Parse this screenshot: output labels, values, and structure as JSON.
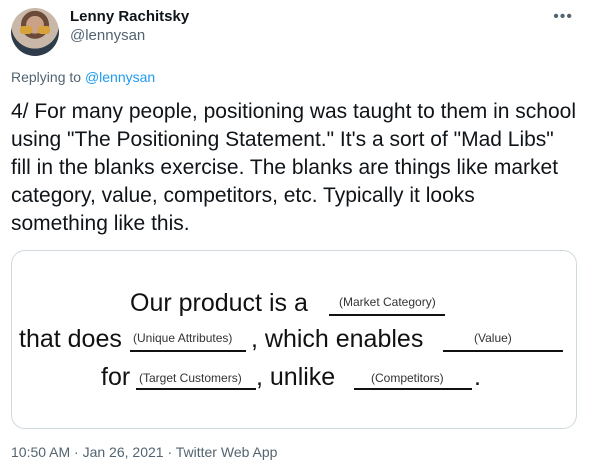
{
  "author": {
    "name": "Lenny Rachitsky",
    "handle": "@lennysan"
  },
  "reply": {
    "prefix": "Replying to",
    "handle": "@lennysan"
  },
  "tweet": {
    "text": "4/ For many people, positioning was taught to them in school using \"The Positioning Statement.\" It's a sort of \"Mad Libs\" fill in the blanks exercise. The blanks are things like market category, value, competitors, etc. Typically it looks something like this."
  },
  "statement": {
    "line1": "Our product is a",
    "line2a": "that does",
    "line2b": ", which enables",
    "line3a": "for",
    "line3b": ", unlike",
    "line3c": ".",
    "blanks": {
      "market_category": "(Market Category)",
      "unique_attributes": "(Unique Attributes)",
      "value": "(Value)",
      "target_customers": "(Target Customers)",
      "competitors": "(Competitors)"
    }
  },
  "meta": {
    "timestamp": "10:50 AM · Jan 26, 2021 · Twitter Web App"
  }
}
